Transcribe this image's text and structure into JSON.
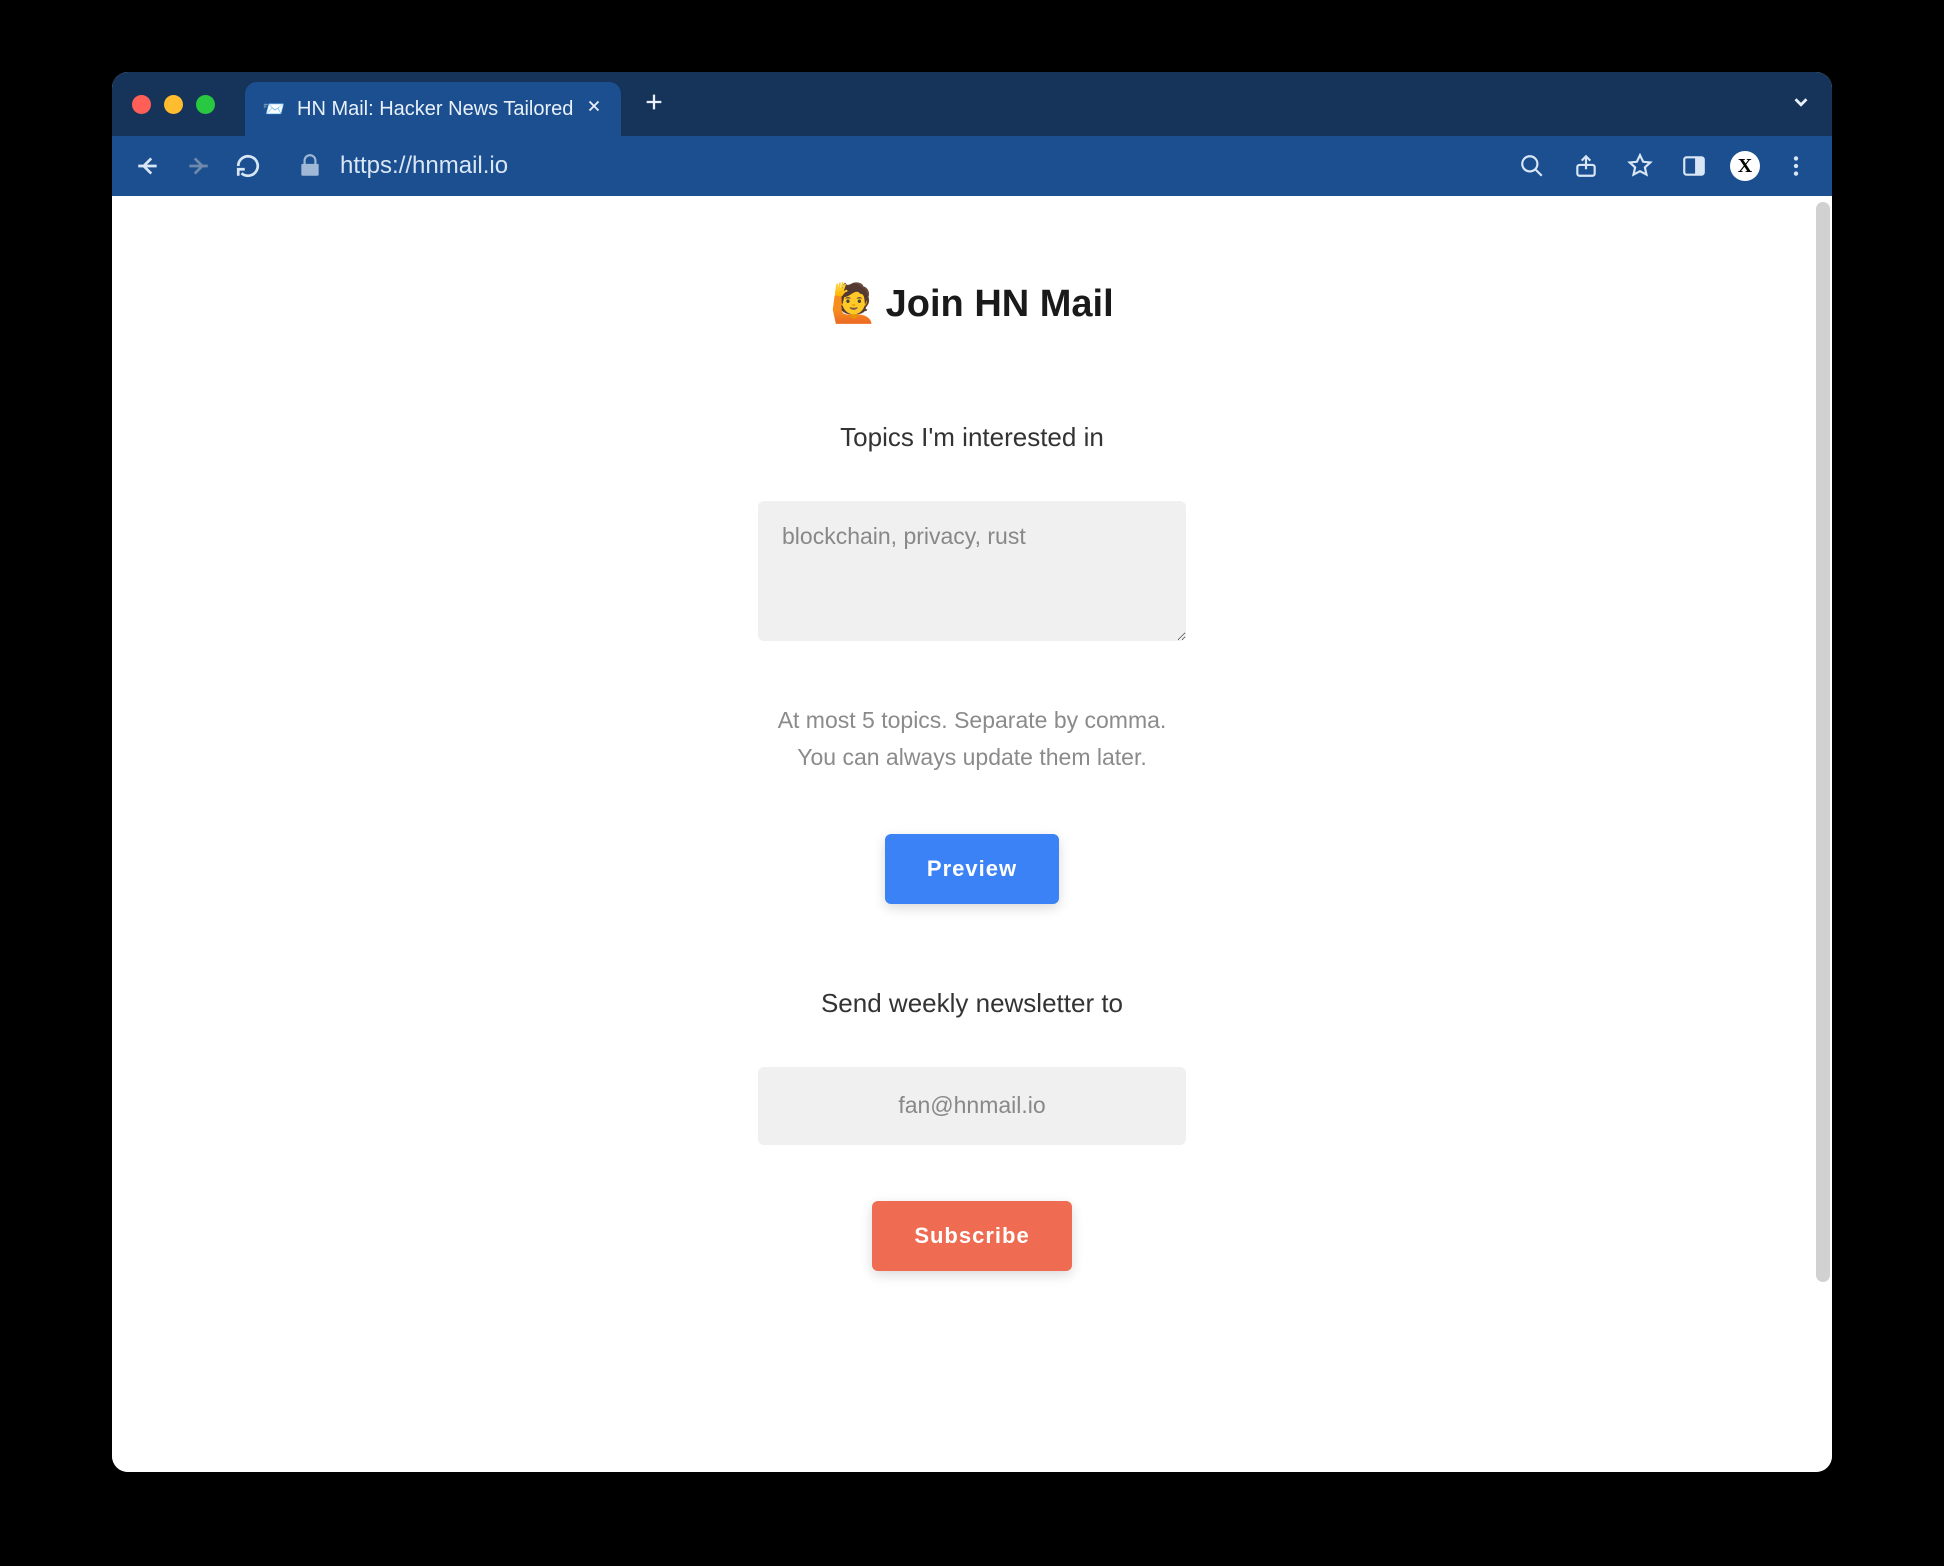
{
  "browser": {
    "tab_title": "HN Mail: Hacker News Tailored",
    "url": "https://hnmail.io",
    "profile_letter": "X"
  },
  "page": {
    "title_emoji": "🙋",
    "title": "Join HN Mail",
    "topics_label": "Topics I'm interested in",
    "topics_placeholder": "blockchain, privacy, rust",
    "hint_line1": "At most 5 topics. Separate by comma.",
    "hint_line2": "You can always update them later.",
    "preview_button": "Preview",
    "email_label": "Send weekly newsletter to",
    "email_placeholder": "fan@hnmail.io",
    "subscribe_button": "Subscribe"
  }
}
